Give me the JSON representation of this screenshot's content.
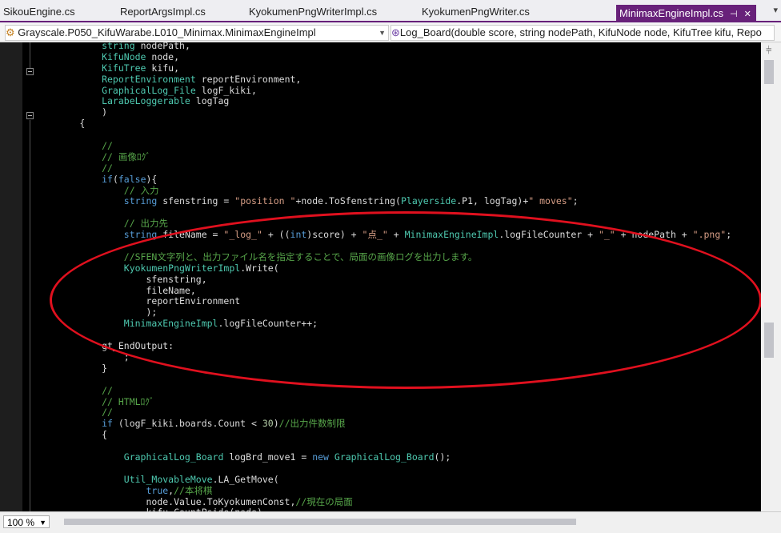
{
  "tabs": [
    {
      "label": "SikouEngine.cs"
    },
    {
      "label": "ReportArgsImpl.cs"
    },
    {
      "label": "KyokumenPngWriterImpl.cs"
    },
    {
      "label": "KyokumenPngWriter.cs"
    },
    {
      "label": "MinimaxEngineImpl.cs"
    }
  ],
  "nav": {
    "left": "Grayscale.P050_KifuWarabe.L010_Minimax.MinimaxEngineImpl",
    "right": "Log_Board(double score, string nodePath, KifuNode node, KifuTree kifu, Repo"
  },
  "status": {
    "zoom": "100 %"
  },
  "code": [
    [
      [
        "t",
        "            string "
      ],
      [
        "p",
        "nodePath,"
      ]
    ],
    [
      [
        "t",
        "            KifuNode "
      ],
      [
        "p",
        "node,"
      ]
    ],
    [
      [
        "t",
        "            KifuTree "
      ],
      [
        "p",
        "kifu,"
      ]
    ],
    [
      [
        "t",
        "            ReportEnvironment "
      ],
      [
        "p",
        "reportEnvironment,"
      ]
    ],
    [
      [
        "t",
        "            GraphicalLog_File "
      ],
      [
        "p",
        "logF_kiki,"
      ]
    ],
    [
      [
        "t",
        "            LarabeLoggerable "
      ],
      [
        "p",
        "logTag"
      ]
    ],
    [
      [
        "p",
        "            )"
      ]
    ],
    [
      [
        "p",
        "        {"
      ]
    ],
    [
      [
        "p",
        ""
      ]
    ],
    [
      [
        "c",
        "            //"
      ]
    ],
    [
      [
        "c",
        "            // 画像ﾛｸﾞ"
      ]
    ],
    [
      [
        "c",
        "            //"
      ]
    ],
    [
      [
        "k",
        "            if"
      ],
      [
        "p",
        "("
      ],
      [
        "k",
        "false"
      ],
      [
        "p",
        "){"
      ]
    ],
    [
      [
        "c",
        "                // 入力"
      ]
    ],
    [
      [
        "k",
        "                string "
      ],
      [
        "p",
        "sfenstring = "
      ],
      [
        "s",
        "\"position \""
      ],
      [
        "p",
        "+node.ToSfenstring("
      ],
      [
        "t",
        "Playerside"
      ],
      [
        "p",
        ".P1, logTag)+"
      ],
      [
        "s",
        "\" moves\""
      ],
      [
        "p",
        ";"
      ]
    ],
    [
      [
        "p",
        ""
      ]
    ],
    [
      [
        "c",
        "                // 出力先"
      ]
    ],
    [
      [
        "k",
        "                string "
      ],
      [
        "p",
        "fileName = "
      ],
      [
        "s",
        "\"_log_\""
      ],
      [
        "p",
        " + (("
      ],
      [
        "k",
        "int"
      ],
      [
        "p",
        ")score) + "
      ],
      [
        "s",
        "\"点_\""
      ],
      [
        "p",
        " + "
      ],
      [
        "t",
        "MinimaxEngineImpl"
      ],
      [
        "p",
        ".logFileCounter + "
      ],
      [
        "s",
        "\"_\""
      ],
      [
        "p",
        " + nodePath + "
      ],
      [
        "s",
        "\".png\""
      ],
      [
        "p",
        ";"
      ]
    ],
    [
      [
        "p",
        ""
      ]
    ],
    [
      [
        "c",
        "                //SFEN文字列と、出力ファイル名を指定することで、局面の画像ログを出力します。"
      ]
    ],
    [
      [
        "t",
        "                KyokumenPngWriterImpl"
      ],
      [
        "p",
        ".Write("
      ]
    ],
    [
      [
        "p",
        "                    sfenstring,"
      ]
    ],
    [
      [
        "p",
        "                    fileName,"
      ]
    ],
    [
      [
        "p",
        "                    reportEnvironment"
      ]
    ],
    [
      [
        "p",
        "                    );"
      ]
    ],
    [
      [
        "t",
        "                MinimaxEngineImpl"
      ],
      [
        "p",
        ".logFileCounter++;"
      ]
    ],
    [
      [
        "p",
        ""
      ]
    ],
    [
      [
        "p",
        "            gt_EndOutput:"
      ]
    ],
    [
      [
        "p",
        "                ;"
      ]
    ],
    [
      [
        "p",
        "            }"
      ]
    ],
    [
      [
        "p",
        ""
      ]
    ],
    [
      [
        "c",
        "            //"
      ]
    ],
    [
      [
        "c",
        "            // HTMLﾛｸﾞ"
      ]
    ],
    [
      [
        "c",
        "            //"
      ]
    ],
    [
      [
        "k",
        "            if "
      ],
      [
        "p",
        "(logF_kiki.boards.Count < "
      ],
      [
        "n",
        "30"
      ],
      [
        "p",
        ")"
      ],
      [
        "c",
        "//出力件数制限"
      ]
    ],
    [
      [
        "p",
        "            {"
      ]
    ],
    [
      [
        "p",
        ""
      ]
    ],
    [
      [
        "t",
        "                GraphicalLog_Board "
      ],
      [
        "p",
        "logBrd_move1 = "
      ],
      [
        "k",
        "new "
      ],
      [
        "t",
        "GraphicalLog_Board"
      ],
      [
        "p",
        "();"
      ]
    ],
    [
      [
        "p",
        ""
      ]
    ],
    [
      [
        "t",
        "                Util_MovableMove"
      ],
      [
        "p",
        ".LA_GetMove("
      ]
    ],
    [
      [
        "k",
        "                    true"
      ],
      [
        "p",
        ","
      ],
      [
        "c",
        "//本将棋"
      ]
    ],
    [
      [
        "p",
        "                    node.Value.ToKyokumenConst,"
      ],
      [
        "c",
        "//現在の局面"
      ]
    ],
    [
      [
        "p",
        "                    kifu.CountPside(node),"
      ]
    ]
  ]
}
